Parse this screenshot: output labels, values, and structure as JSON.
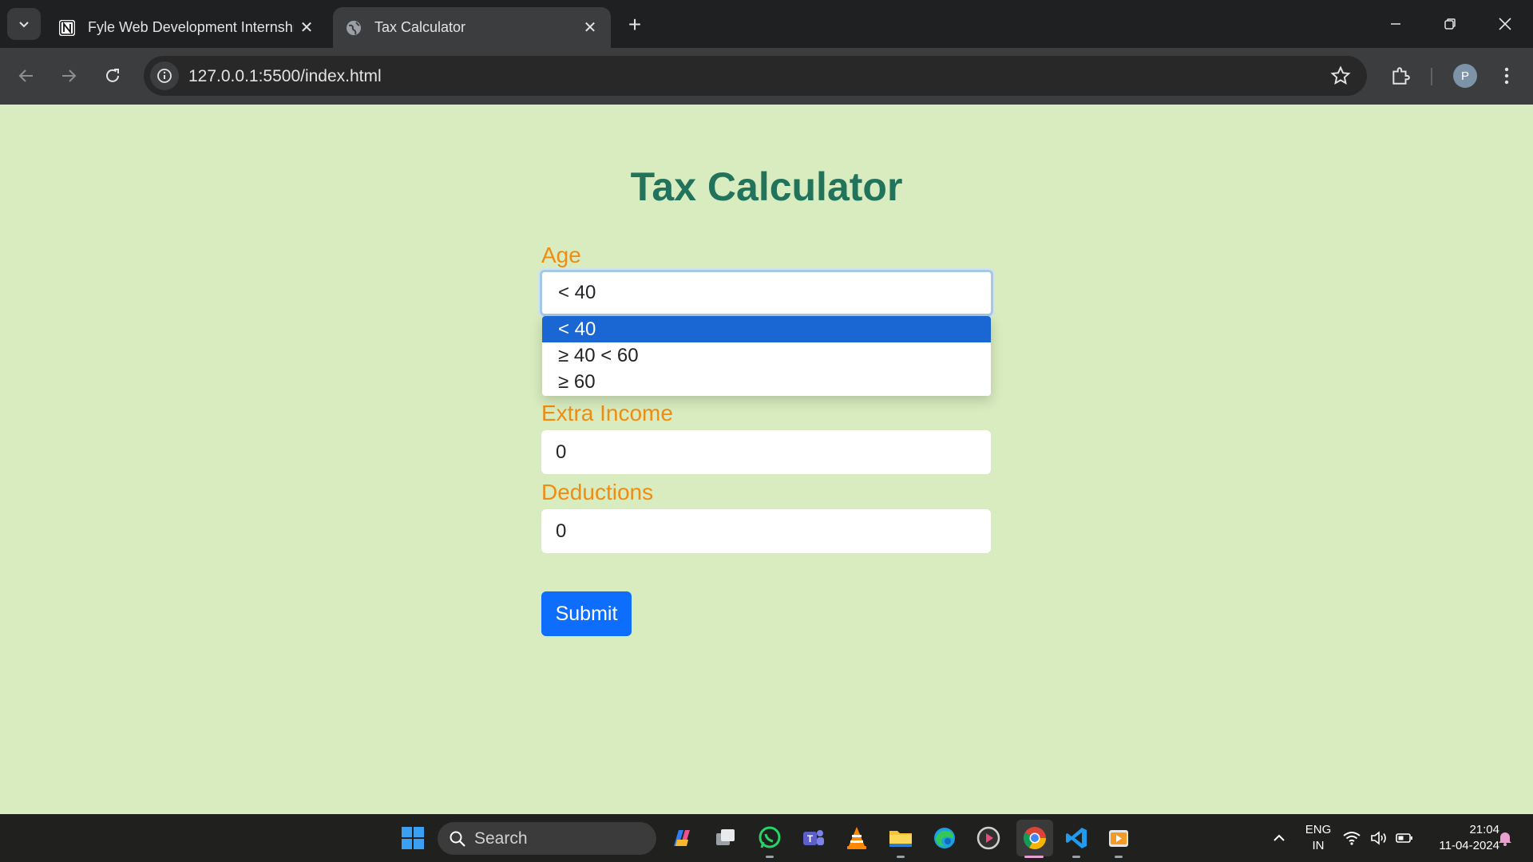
{
  "browser": {
    "tabs": [
      {
        "title": "Fyle Web Development Internship",
        "active": false
      },
      {
        "title": "Tax Calculator",
        "active": true
      }
    ],
    "url": "127.0.0.1:5500/index.html",
    "profile_initial": "P"
  },
  "page": {
    "title": "Tax Calculator",
    "age_label": "Age",
    "age_value": "< 40",
    "age_options": [
      "< 40",
      "≥ 40 < 60",
      "≥ 60"
    ],
    "extra_income_label": "Extra Income",
    "extra_income_value": "0",
    "deductions_label": "Deductions",
    "deductions_value": "0",
    "submit_label": "Submit"
  },
  "taskbar": {
    "search_label": "Search",
    "language_line1": "ENG",
    "language_line2": "IN",
    "time": "21:04",
    "date": "11-04-2024"
  },
  "colors": {
    "page_background": "#d9ecbf",
    "title": "#22735c",
    "label": "#ef8c14",
    "submit": "#0d6efd",
    "option_highlight": "#1a66d2"
  }
}
